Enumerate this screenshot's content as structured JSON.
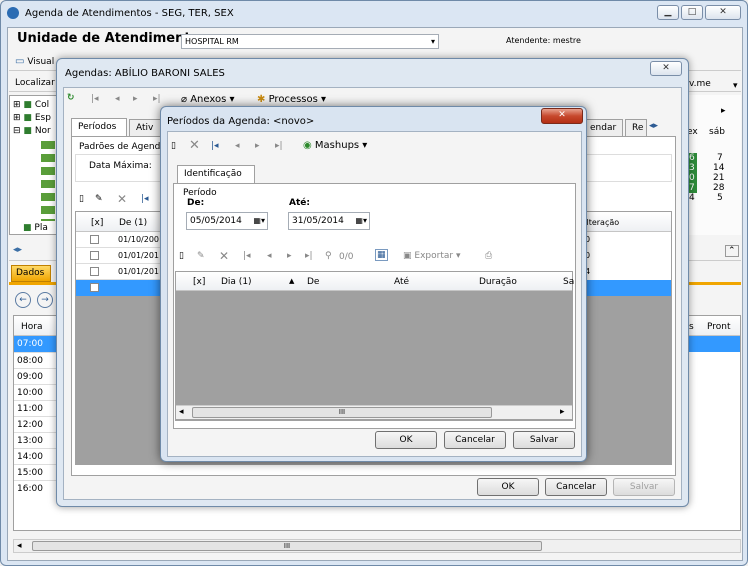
{
  "main_window": {
    "title": "Agenda de Atendimentos - SEG, TER, SEX",
    "unit_label": "Unidade de Atendimento",
    "unit_value": "HOSPITAL RM",
    "attendant": "Atendente: mestre",
    "toolbar_visual": "Visual",
    "localizar": "Localizar",
    "right_label": "v.me",
    "tree_items": [
      "Col",
      "Esp",
      "Nor",
      "Pla"
    ],
    "calendar_header": [
      "ex",
      "sáb"
    ],
    "calendar_rows": [
      [
        "6",
        "7"
      ],
      [
        "3",
        "14"
      ],
      [
        "0",
        "21"
      ],
      [
        "7",
        "28"
      ],
      [
        "4",
        "5"
      ]
    ],
    "tab_dados": "Dados",
    "grid_headers": [
      "Hora",
      "s",
      "Pront"
    ],
    "hours": [
      "07:00",
      "08:00",
      "09:00",
      "10:00",
      "11:00",
      "12:00",
      "13:00",
      "14:00",
      "15:00",
      "16:00"
    ],
    "scroll_mid": "III"
  },
  "agenda_window": {
    "title": "Agendas: ABÍLIO BARONI SALES",
    "menu_anexos": "Anexos",
    "menu_processos": "Processos",
    "tabs": [
      "Períodos",
      "Ativ",
      "endar",
      "Re"
    ],
    "padroes_label": "Padrões de Agenda",
    "data_maxima": "Data Máxima:",
    "col_x": "[x]",
    "col_de": "De (1)",
    "col_alt": "Alteração",
    "rows": [
      {
        "de": "01/10/200",
        "alt": "0"
      },
      {
        "de": "01/01/201",
        "alt": "0"
      },
      {
        "de": "01/01/201",
        "alt": "4"
      }
    ],
    "ok": "OK",
    "cancelar": "Cancelar",
    "salvar": "Salvar"
  },
  "periodos_dialog": {
    "title": "Períodos da Agenda: <novo>",
    "mashups": "Mashups",
    "tab_ident": "Identificação",
    "periodo_label": "Período",
    "de_label": "De:",
    "ate_label": "Até:",
    "de_value": "05/05/2014",
    "ate_value": "31/05/2014",
    "count": "0/0",
    "exportar": "Exportar",
    "col_x": "[x]",
    "col_dia": "Dia (1)",
    "col_de": "De",
    "col_ate": "Até",
    "col_duracao": "Duração",
    "col_sa": "Sa",
    "scroll_mid": "III",
    "ok": "OK",
    "cancelar": "Cancelar",
    "salvar": "Salvar"
  }
}
